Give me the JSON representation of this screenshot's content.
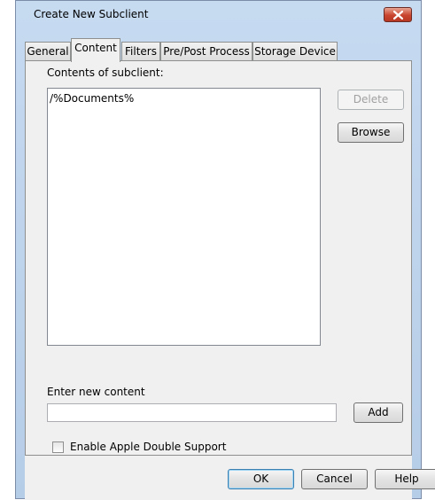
{
  "dialog": {
    "title": "Create New Subclient",
    "close_icon": "close-icon"
  },
  "tabs": [
    {
      "label": "General",
      "active": false
    },
    {
      "label": "Content",
      "active": true
    },
    {
      "label": "Filters",
      "active": false
    },
    {
      "label": "Pre/Post Process",
      "active": false
    },
    {
      "label": "Storage Device",
      "active": false
    }
  ],
  "content": {
    "contents_label": "Contents of subclient:",
    "items": [
      "/%Documents%"
    ],
    "delete_label": "Delete",
    "browse_label": "Browse",
    "new_content_label": "Enter new content",
    "new_content_value": "",
    "add_label": "Add",
    "apple_double_label": "Enable Apple Double Support",
    "apple_double_checked": false
  },
  "footer": {
    "ok_label": "OK",
    "cancel_label": "Cancel",
    "help_label": "Help"
  }
}
